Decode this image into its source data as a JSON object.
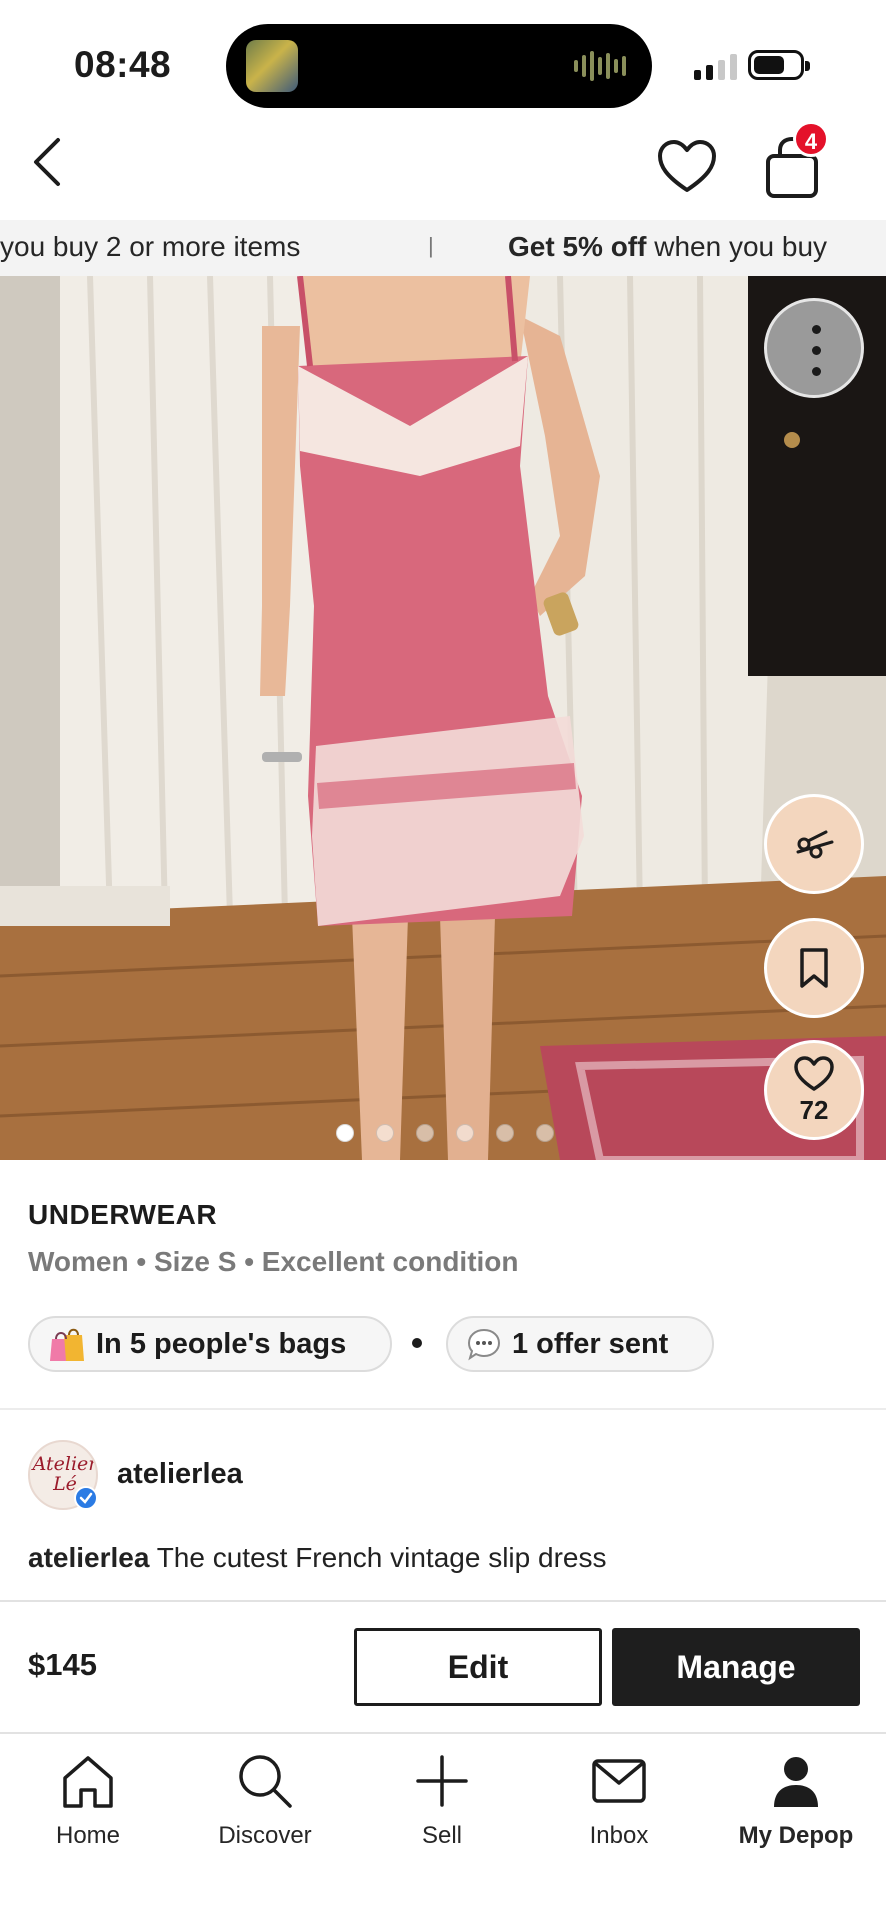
{
  "status_bar": {
    "time": "08:48"
  },
  "nav": {
    "cart_count": "4"
  },
  "promo": {
    "segment_a": "you buy 2 or more items",
    "separator": "|",
    "segment_b_bold": "Get 5% off",
    "segment_b_rest": " when you buy"
  },
  "gallery": {
    "image_count": 6,
    "active_index": 0,
    "likes": "72"
  },
  "product": {
    "category": "UNDERWEAR",
    "meta": "Women • Size S • Excellent condition",
    "bags_pill": "In 5 people's bags",
    "offer_pill": "1 offer sent"
  },
  "seller": {
    "username": "atelierlea",
    "avatar_text_1": "Atelier",
    "avatar_text_2": "Lé",
    "description_user": "atelierlea",
    "description_text": " The cutest French vintage slip dress"
  },
  "actions": {
    "price": "$145",
    "edit_label": "Edit",
    "manage_label": "Manage"
  },
  "tabs": [
    {
      "label": "Home",
      "icon": "home-icon",
      "active": false
    },
    {
      "label": "Discover",
      "icon": "search-icon",
      "active": false
    },
    {
      "label": "Sell",
      "icon": "plus-icon",
      "active": false
    },
    {
      "label": "Inbox",
      "icon": "mail-icon",
      "active": false
    },
    {
      "label": "My Depop",
      "icon": "profile-icon",
      "active": true
    }
  ],
  "colors": {
    "badge": "#e4112a",
    "fab_background": "#f3d6be",
    "primary_button": "#1e1e1e",
    "muted_text": "#7a7a7a",
    "dress_pink": "#d8687c"
  }
}
